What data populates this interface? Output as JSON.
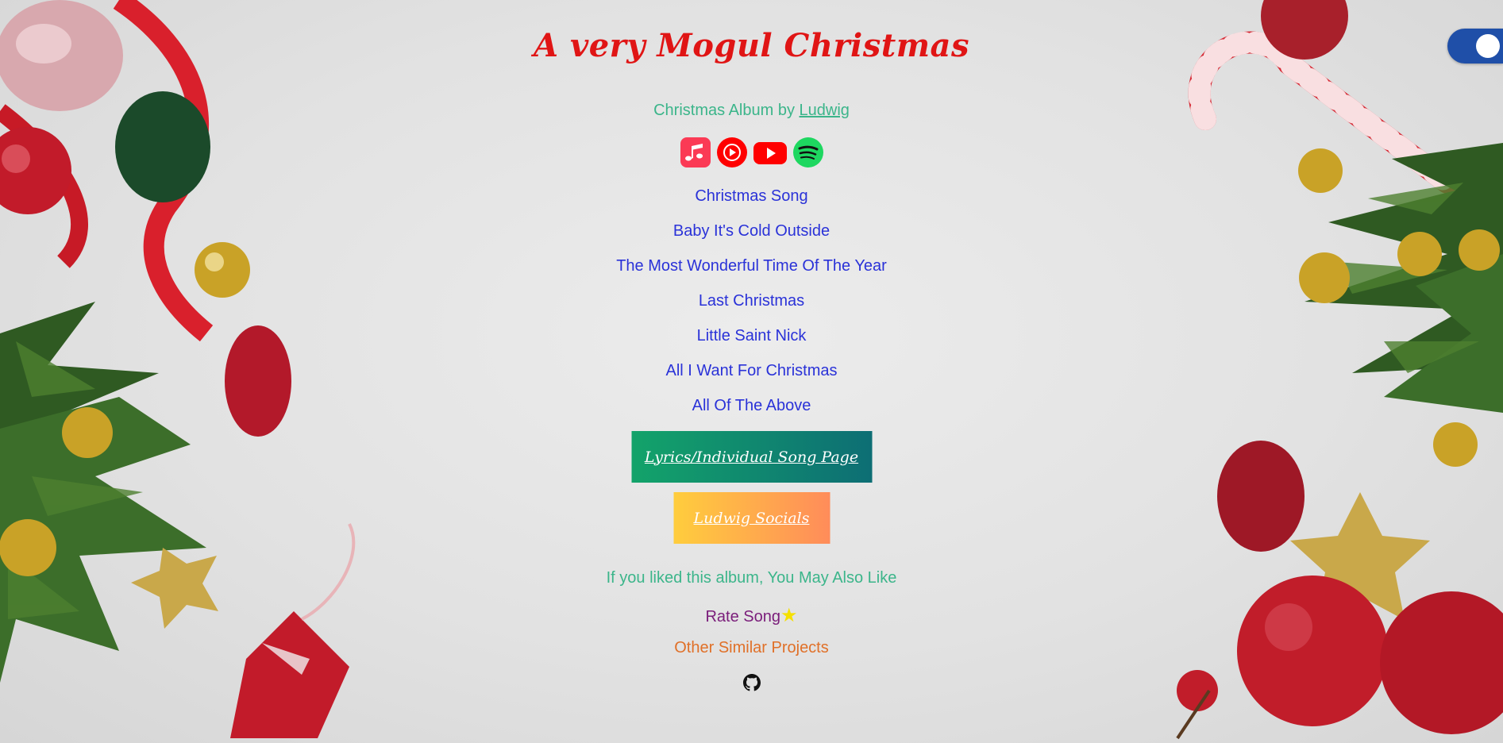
{
  "header": {
    "title": "A very Mogul Christmas",
    "subtitle_prefix": "Christmas Album by ",
    "artist_link": "Ludwig"
  },
  "platforms": [
    {
      "name": "apple-music-icon",
      "color": "#fb3a55"
    },
    {
      "name": "youtube-music-icon",
      "color": "#ff0000"
    },
    {
      "name": "youtube-icon",
      "color": "#ff0000"
    },
    {
      "name": "spotify-icon",
      "color": "#1ed760"
    }
  ],
  "songs": [
    "Christmas Song",
    "Baby It's Cold Outside",
    "The Most Wonderful Time Of The Year",
    "Last Christmas",
    "Little Saint Nick",
    "All I Want For Christmas",
    "All Of The Above"
  ],
  "buttons": {
    "lyrics_label": "Lyrics/Individual Song Page",
    "socials_label": "Ludwig Socials"
  },
  "footer": {
    "also_like": "If you liked this album, You May Also Like",
    "rate_song": "Rate Song",
    "other_projects": "Other Similar Projects",
    "github_icon": "github-icon"
  },
  "theme_toggle": {
    "state": "on",
    "color": "#1f4fa8"
  },
  "colors": {
    "title": "#e01515",
    "teal_text": "#3bb58a",
    "song_link": "#2a32d8",
    "rate": "#7a1d7a",
    "other": "#e07028"
  }
}
